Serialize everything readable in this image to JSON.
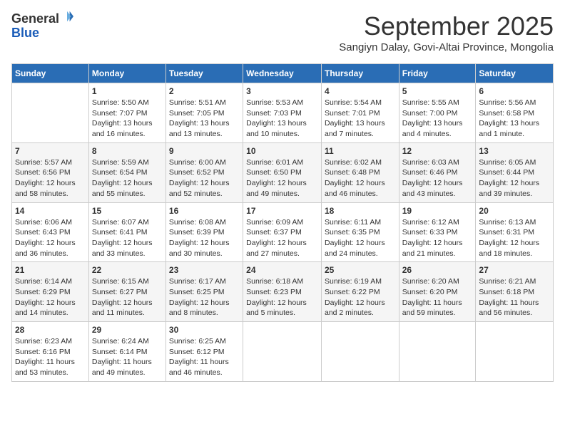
{
  "logo": {
    "general": "General",
    "blue": "Blue"
  },
  "header": {
    "month_title": "September 2025",
    "subtitle": "Sangiyn Dalay, Govi-Altai Province, Mongolia"
  },
  "columns": [
    "Sunday",
    "Monday",
    "Tuesday",
    "Wednesday",
    "Thursday",
    "Friday",
    "Saturday"
  ],
  "weeks": [
    [
      {
        "day": "",
        "info": ""
      },
      {
        "day": "1",
        "info": "Sunrise: 5:50 AM\nSunset: 7:07 PM\nDaylight: 13 hours\nand 16 minutes."
      },
      {
        "day": "2",
        "info": "Sunrise: 5:51 AM\nSunset: 7:05 PM\nDaylight: 13 hours\nand 13 minutes."
      },
      {
        "day": "3",
        "info": "Sunrise: 5:53 AM\nSunset: 7:03 PM\nDaylight: 13 hours\nand 10 minutes."
      },
      {
        "day": "4",
        "info": "Sunrise: 5:54 AM\nSunset: 7:01 PM\nDaylight: 13 hours\nand 7 minutes."
      },
      {
        "day": "5",
        "info": "Sunrise: 5:55 AM\nSunset: 7:00 PM\nDaylight: 13 hours\nand 4 minutes."
      },
      {
        "day": "6",
        "info": "Sunrise: 5:56 AM\nSunset: 6:58 PM\nDaylight: 13 hours\nand 1 minute."
      }
    ],
    [
      {
        "day": "7",
        "info": "Sunrise: 5:57 AM\nSunset: 6:56 PM\nDaylight: 12 hours\nand 58 minutes."
      },
      {
        "day": "8",
        "info": "Sunrise: 5:59 AM\nSunset: 6:54 PM\nDaylight: 12 hours\nand 55 minutes."
      },
      {
        "day": "9",
        "info": "Sunrise: 6:00 AM\nSunset: 6:52 PM\nDaylight: 12 hours\nand 52 minutes."
      },
      {
        "day": "10",
        "info": "Sunrise: 6:01 AM\nSunset: 6:50 PM\nDaylight: 12 hours\nand 49 minutes."
      },
      {
        "day": "11",
        "info": "Sunrise: 6:02 AM\nSunset: 6:48 PM\nDaylight: 12 hours\nand 46 minutes."
      },
      {
        "day": "12",
        "info": "Sunrise: 6:03 AM\nSunset: 6:46 PM\nDaylight: 12 hours\nand 43 minutes."
      },
      {
        "day": "13",
        "info": "Sunrise: 6:05 AM\nSunset: 6:44 PM\nDaylight: 12 hours\nand 39 minutes."
      }
    ],
    [
      {
        "day": "14",
        "info": "Sunrise: 6:06 AM\nSunset: 6:43 PM\nDaylight: 12 hours\nand 36 minutes."
      },
      {
        "day": "15",
        "info": "Sunrise: 6:07 AM\nSunset: 6:41 PM\nDaylight: 12 hours\nand 33 minutes."
      },
      {
        "day": "16",
        "info": "Sunrise: 6:08 AM\nSunset: 6:39 PM\nDaylight: 12 hours\nand 30 minutes."
      },
      {
        "day": "17",
        "info": "Sunrise: 6:09 AM\nSunset: 6:37 PM\nDaylight: 12 hours\nand 27 minutes."
      },
      {
        "day": "18",
        "info": "Sunrise: 6:11 AM\nSunset: 6:35 PM\nDaylight: 12 hours\nand 24 minutes."
      },
      {
        "day": "19",
        "info": "Sunrise: 6:12 AM\nSunset: 6:33 PM\nDaylight: 12 hours\nand 21 minutes."
      },
      {
        "day": "20",
        "info": "Sunrise: 6:13 AM\nSunset: 6:31 PM\nDaylight: 12 hours\nand 18 minutes."
      }
    ],
    [
      {
        "day": "21",
        "info": "Sunrise: 6:14 AM\nSunset: 6:29 PM\nDaylight: 12 hours\nand 14 minutes."
      },
      {
        "day": "22",
        "info": "Sunrise: 6:15 AM\nSunset: 6:27 PM\nDaylight: 12 hours\nand 11 minutes."
      },
      {
        "day": "23",
        "info": "Sunrise: 6:17 AM\nSunset: 6:25 PM\nDaylight: 12 hours\nand 8 minutes."
      },
      {
        "day": "24",
        "info": "Sunrise: 6:18 AM\nSunset: 6:23 PM\nDaylight: 12 hours\nand 5 minutes."
      },
      {
        "day": "25",
        "info": "Sunrise: 6:19 AM\nSunset: 6:22 PM\nDaylight: 12 hours\nand 2 minutes."
      },
      {
        "day": "26",
        "info": "Sunrise: 6:20 AM\nSunset: 6:20 PM\nDaylight: 11 hours\nand 59 minutes."
      },
      {
        "day": "27",
        "info": "Sunrise: 6:21 AM\nSunset: 6:18 PM\nDaylight: 11 hours\nand 56 minutes."
      }
    ],
    [
      {
        "day": "28",
        "info": "Sunrise: 6:23 AM\nSunset: 6:16 PM\nDaylight: 11 hours\nand 53 minutes."
      },
      {
        "day": "29",
        "info": "Sunrise: 6:24 AM\nSunset: 6:14 PM\nDaylight: 11 hours\nand 49 minutes."
      },
      {
        "day": "30",
        "info": "Sunrise: 6:25 AM\nSunset: 6:12 PM\nDaylight: 11 hours\nand 46 minutes."
      },
      {
        "day": "",
        "info": ""
      },
      {
        "day": "",
        "info": ""
      },
      {
        "day": "",
        "info": ""
      },
      {
        "day": "",
        "info": ""
      }
    ]
  ]
}
